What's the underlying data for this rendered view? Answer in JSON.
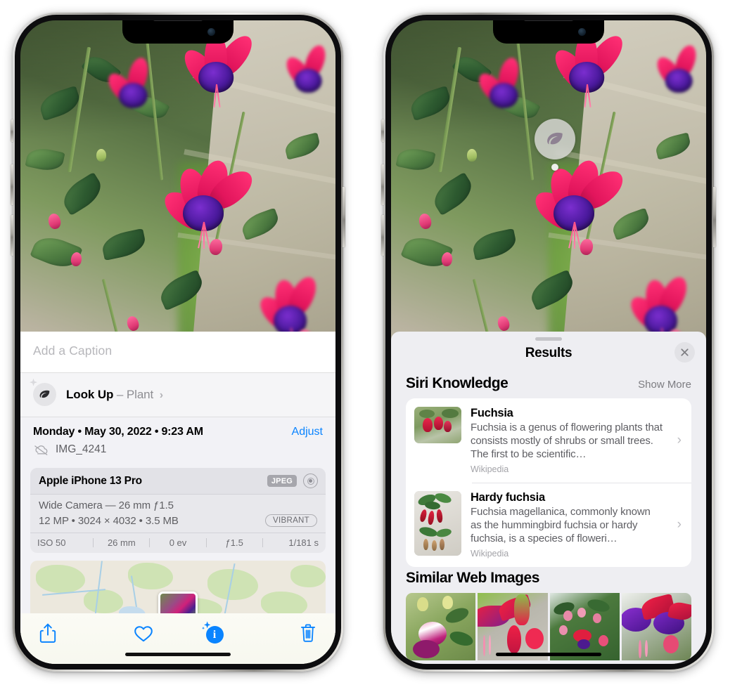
{
  "meta": {
    "scene": "Two iPhone screenshots side by side showing Photos app Visual Look Up",
    "accent_blue": "#0a84ff",
    "sheet_bg": "#f2f2f6"
  },
  "left_phone": {
    "name": "photos-info-view",
    "caption": {
      "placeholder": "Add a Caption",
      "value": ""
    },
    "lookup": {
      "icon": "leaf-icon",
      "sparkle_icon": "sparkle-icon",
      "label": "Look Up",
      "dash": "–",
      "subject": "Plant",
      "chevron": "›"
    },
    "info": {
      "date": "Monday • May 30, 2022 • 9:23 AM",
      "adjust_label": "Adjust",
      "cloud_icon": "cloud-slash-icon",
      "filename": "IMG_4241"
    },
    "camera_card": {
      "device": "Apple iPhone 13 Pro",
      "format_badge": "JPEG",
      "raw_icon": "raw-target-icon",
      "lens": "Wide Camera — 26 mm ƒ1.5",
      "dimensions": "12 MP • 3024 × 4032 • 3.5 MB",
      "style_badge": "VIBRANT",
      "exif": [
        "ISO 50",
        "26 mm",
        "0 ev",
        "ƒ1.5",
        "1/181 s"
      ]
    },
    "map": {
      "pin_label": "photo-location-thumbnail"
    },
    "toolbar": [
      {
        "name": "share-button",
        "icon": "share-icon"
      },
      {
        "name": "favorite-button",
        "icon": "heart-icon"
      },
      {
        "name": "info-button",
        "icon": "info-sparkle-icon"
      },
      {
        "name": "delete-button",
        "icon": "trash-icon"
      }
    ]
  },
  "right_phone": {
    "name": "visual-lookup-results-view",
    "photo_badge": {
      "icon": "leaf-icon",
      "name": "visual-lookup-leaf-badge"
    },
    "sheet": {
      "grabber": "sheet-grabber",
      "title": "Results",
      "close_icon": "close-icon"
    },
    "siri_knowledge": {
      "heading": "Siri Knowledge",
      "show_more": "Show More",
      "results": [
        {
          "title": "Fuchsia",
          "description": "Fuchsia is a genus of flowering plants that consists mostly of shrubs or small trees. The first to be scientific…",
          "source": "Wikipedia",
          "chevron": "›"
        },
        {
          "title": "Hardy fuchsia",
          "description": "Fuchsia magellanica, commonly known as the hummingbird fuchsia or hardy fuchsia, is a species of floweri…",
          "source": "Wikipedia",
          "chevron": "›"
        }
      ]
    },
    "similar_web_images": {
      "heading": "Similar Web Images",
      "thumbnails": [
        "fuchsia-pink-white-bloom",
        "fuchsia-red-magenta-closeup",
        "fuchsia-shrub-buds",
        "fuchsia-purple-red-cluster"
      ]
    }
  }
}
